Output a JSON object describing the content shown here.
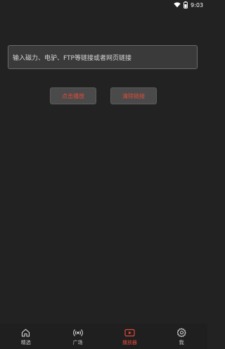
{
  "status_bar": {
    "time": "9:03",
    "wifi_icon": "wifi-icon",
    "battery_icon": "battery-icon"
  },
  "input": {
    "placeholder": "输入磁力、电驴、FTP等链接或者网页链接"
  },
  "buttons": {
    "play_label": "点击播放",
    "clear_label": "清除链接"
  },
  "nav": {
    "items": [
      {
        "label": "精选",
        "icon": "home-icon",
        "active": false
      },
      {
        "label": "广场",
        "icon": "broadcast-icon",
        "active": false
      },
      {
        "label": "播放器",
        "icon": "player-icon",
        "active": true
      },
      {
        "label": "我",
        "icon": "gear-icon",
        "active": false
      }
    ]
  },
  "colors": {
    "background": "#222222",
    "accent": "#e24a3b"
  }
}
